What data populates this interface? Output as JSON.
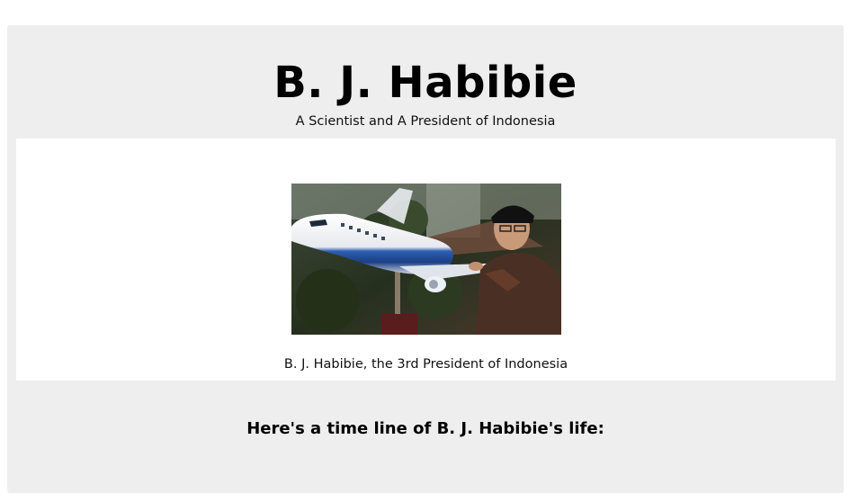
{
  "header": {
    "title": "B. J. Habibie",
    "subtitle": "A Scientist and A President of Indonesia"
  },
  "figure": {
    "caption": "B. J. Habibie, the 3rd President of Indonesia",
    "image_subject": "B. J. Habibie touching a model airplane"
  },
  "timeline": {
    "heading": "Here's a time line of B. J. Habibie's life:"
  }
}
